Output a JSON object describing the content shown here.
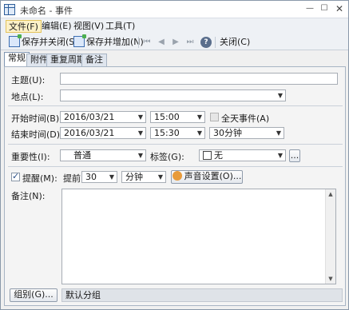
{
  "window": {
    "title": "未命名 - 事件"
  },
  "menu": {
    "items": [
      "文件(F)",
      "编辑(E)",
      "视图(V)",
      "工具(T)"
    ]
  },
  "toolbar": {
    "save_close": "保存并关闭(S)",
    "save_new": "保存并增加(N)",
    "close": "关闭(C)"
  },
  "tabs": [
    "常规",
    "附件",
    "重复周期",
    "备注"
  ],
  "form": {
    "subject_label": "主题(U):",
    "subject_value": "",
    "location_label": "地点(L):",
    "location_value": "",
    "start_label": "开始时间(B):",
    "start_date": "2016/03/21",
    "start_time": "15:00",
    "allday_label": "全天事件(A)",
    "end_label": "结束时间(D):",
    "end_date": "2016/03/21",
    "end_time": "15:30",
    "duration": "30分钟",
    "importance_label": "重要性(I):",
    "importance_value": "普通",
    "tag_label": "标签(G):",
    "tag_value": "无",
    "tag_more": "...",
    "reminder_label": "提醒(M):",
    "reminder_before": "提前",
    "reminder_amount": "30",
    "reminder_unit": "分钟",
    "sound_button": "声音设置(O)...",
    "notes_label": "备注(N):",
    "notes_value": "",
    "group_button": "组别(G)...",
    "group_value": "默认分组"
  },
  "icons": {
    "app": "calendar-grid-icon",
    "save_close": "save-close-icon",
    "save_new": "save-new-icon",
    "help": "help-icon",
    "sound": "sound-icon"
  }
}
